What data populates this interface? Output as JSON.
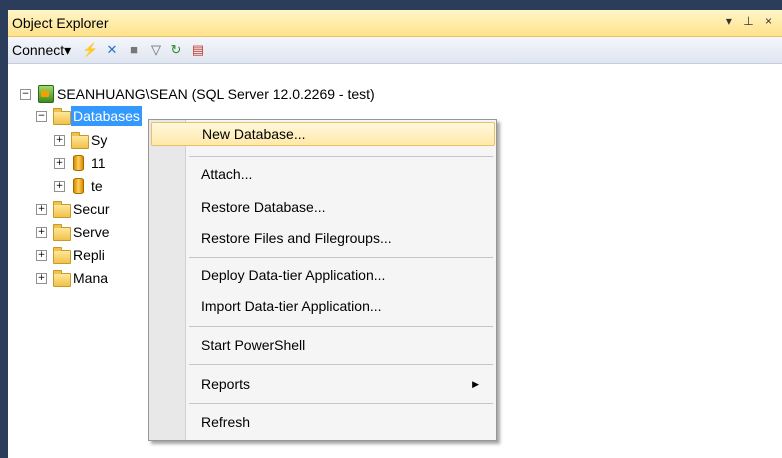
{
  "window": {
    "title": "Object Explorer",
    "pin_glyphs": "▾ ⊥ ×"
  },
  "toolbar": {
    "connect_label": "Connect▾",
    "icons": [
      "connect-icon",
      "disconnect-icon",
      "stop-icon",
      "filter-icon",
      "refresh-icon",
      "activity-icon"
    ]
  },
  "tree": {
    "server_label": "SEANHUANG\\SEAN (SQL Server 12.0.2269 - test)",
    "databases_label": "Databases",
    "child_sy": "Sy",
    "child_11": "11",
    "child_te": "te",
    "secur": "Secur",
    "serve": "Serve",
    "repli": "Repli",
    "mana": "Mana"
  },
  "context_menu": {
    "new_database": "New Database...",
    "attach": "Attach...",
    "restore_database": "Restore Database...",
    "restore_files": "Restore Files and Filegroups...",
    "deploy_dac": "Deploy Data-tier Application...",
    "import_dac": "Import Data-tier Application...",
    "start_powershell": "Start PowerShell",
    "reports": "Reports",
    "refresh": "Refresh"
  }
}
